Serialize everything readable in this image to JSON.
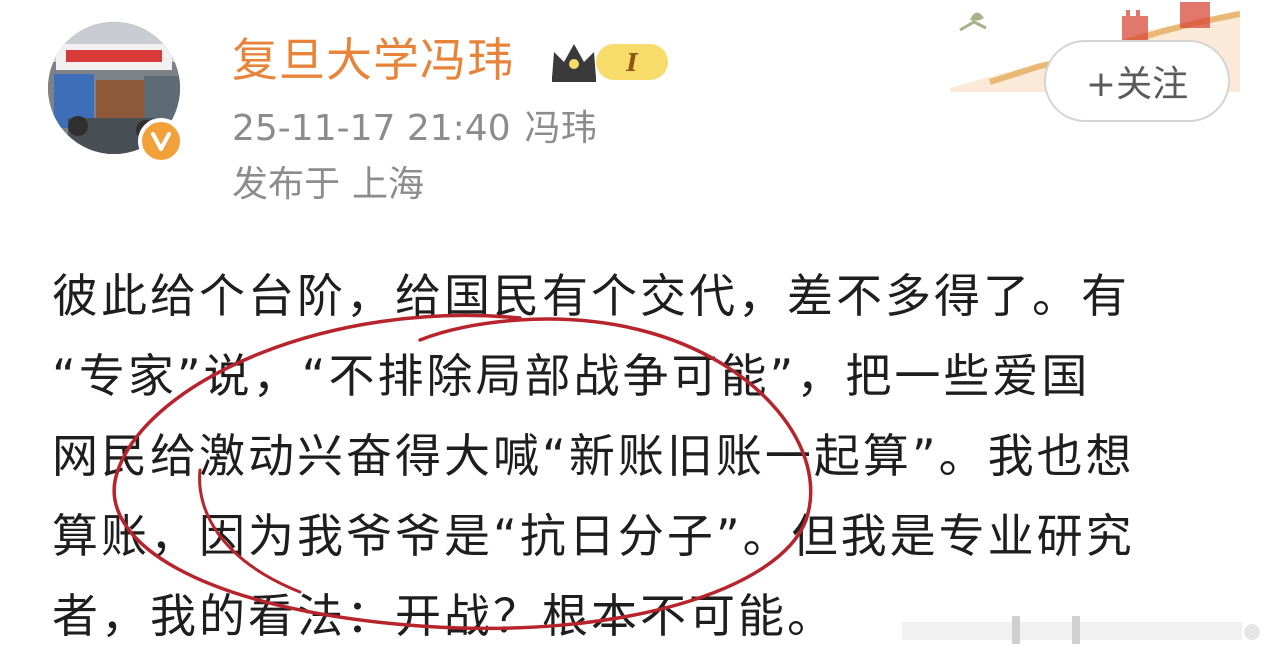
{
  "post": {
    "author": {
      "name": "复旦大学冯玮",
      "member_level": "I",
      "avatar_icon": "avatar-photo",
      "verified_icon": "verified-v-icon"
    },
    "meta": {
      "datetime": "25-11-17 21:40",
      "source": "冯玮",
      "location_prefix": "发布于",
      "location": "上海"
    },
    "follow_button": {
      "label": "+关注"
    },
    "content": {
      "lines": [
        "彼此给个台阶，给国民有个交代，差不多得了。有",
        "“专家”说，“不排除局部战争可能”，把一些爱国",
        "网民给激动兴奋得大喊“新账旧账一起算”。我也想",
        "算账，因为我爷爷是“抗日分子”。但我是专业研究",
        "者，我的看法：开战？根本不可能。"
      ]
    },
    "colors": {
      "username": "#e8833a",
      "meta_text": "#8c8c8c",
      "body_text": "#1e1e1e",
      "annotation_circle": "#b8242c",
      "member_badge": "#f7dc6b",
      "verified_badge": "#f2a13a"
    }
  }
}
